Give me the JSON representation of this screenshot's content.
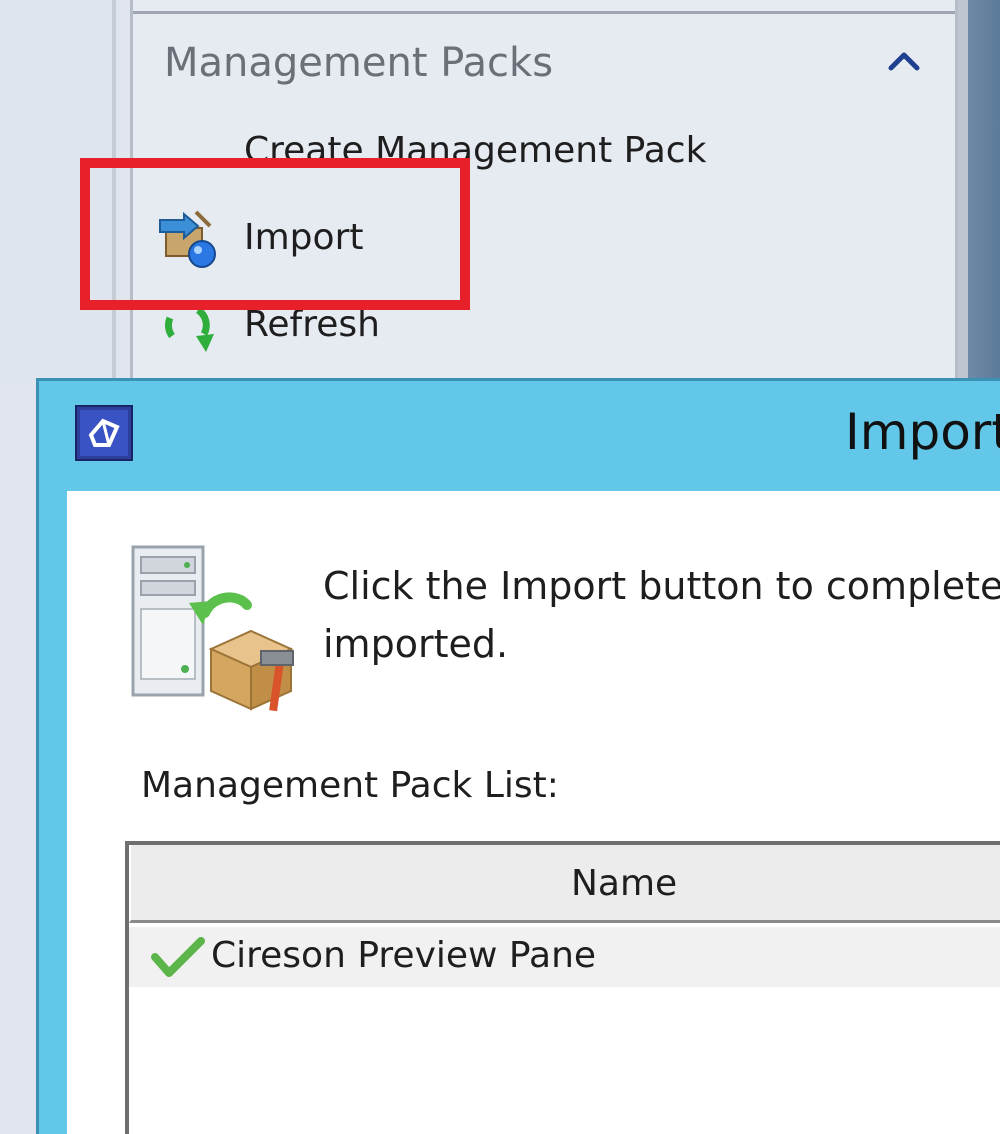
{
  "tasks_pane": {
    "section_title": "Management Packs",
    "collapse_icon": "chevron-up-icon",
    "items": [
      {
        "label": "Create Management Pack",
        "icon": "none"
      },
      {
        "label": "Import",
        "icon": "import-icon"
      },
      {
        "label": "Refresh",
        "icon": "refresh-icon"
      }
    ],
    "highlight_color": "#e8202a"
  },
  "dialog": {
    "title": "Import",
    "title_icon": "management-pack-app-icon",
    "header_color": "#62c7e8",
    "instruction_line1": "Click the Import button to complete t",
    "instruction_line2": "imported.",
    "list_label": "Management Pack List:",
    "columns": [
      "Name"
    ],
    "rows": [
      {
        "status_icon": "checkmark-icon",
        "name": "Cireson Preview Pane"
      }
    ]
  }
}
